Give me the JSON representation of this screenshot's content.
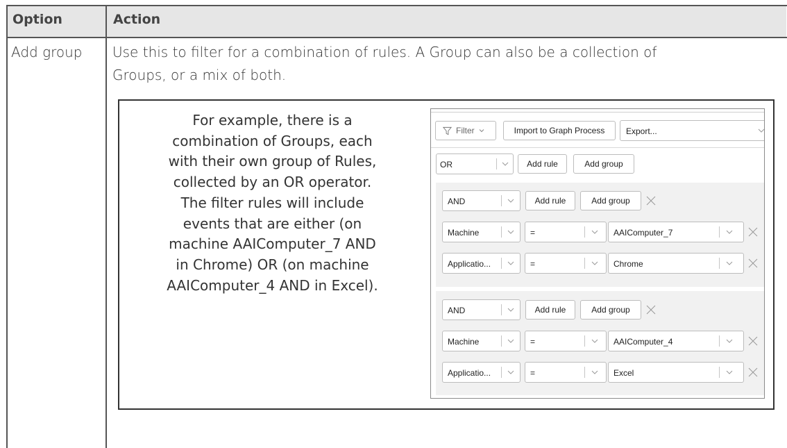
{
  "table": {
    "header_option": "Option",
    "header_action": "Action",
    "row_option": "Add group",
    "row_action_line1": "Use this to filter for a combination of rules. A Group can also be a collection of",
    "row_action_line2": "Groups, or a mix of both."
  },
  "example": {
    "lines": [
      "For example, there is a",
      "combination of Groups, each",
      "with their own group of Rules,",
      "collected by an OR operator.",
      "The filter rules will include",
      "events that are either (on",
      "machine AAIComputer_7 AND",
      "in Chrome) OR (on machine",
      "AAIComputer_4 AND in Excel)."
    ]
  },
  "screenshot": {
    "toolbar": {
      "filter_label": "Filter",
      "import_label": "Import to Graph Process",
      "export_value": "Export..."
    },
    "root": {
      "operator": "OR",
      "add_rule": "Add rule",
      "add_group": "Add group"
    },
    "group1": {
      "operator": "AND",
      "add_rule": "Add rule",
      "add_group": "Add group",
      "rules": [
        {
          "field": "Machine",
          "op": "=",
          "value": "AAIComputer_7"
        },
        {
          "field": "Applicatio...",
          "op": "=",
          "value": "Chrome"
        }
      ]
    },
    "group2": {
      "operator": "AND",
      "add_rule": "Add rule",
      "add_group": "Add group",
      "rules": [
        {
          "field": "Machine",
          "op": "=",
          "value": "AAIComputer_4"
        },
        {
          "field": "Applicatio...",
          "op": "=",
          "value": "Excel"
        }
      ]
    }
  }
}
